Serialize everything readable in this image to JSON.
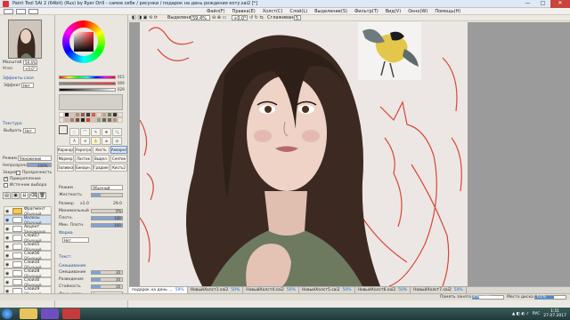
{
  "window": {
    "title": "Paint Tool SAI 2 (64bit) (Rus) by Ryer Drill - самое себе / рисунки / подарок на день рождения коту.sai2 [*]",
    "minimize": "—",
    "maximize": "□",
    "close": "✕"
  },
  "menu": [
    "Файл(F)",
    "Правка(E)",
    "Холст(C)",
    "Слой(L)",
    "Выделение(S)",
    "Фильтр(T)",
    "Вид(V)",
    "Окно(W)",
    "Помощь(H)"
  ],
  "toolbar": {
    "selection_label": "Выделение",
    "zoom_value": "59.4%",
    "rotation_value": "+0.0°",
    "smoothing_label": "Сглаживание",
    "smoothing_value": "5"
  },
  "navigator": {
    "zoom_label": "Масштаб",
    "zoom_value": "59.4%",
    "angle_label": "Угол",
    "angle_value": "+0.0°"
  },
  "layer_props": {
    "effects_label": "Эффекты слоя",
    "effect_label": "Эффект",
    "effect_value": "Нет",
    "texture_label": "Текстура",
    "texture_select_label": "Выбрать",
    "texture_value": "Нет",
    "mode_label": "Режим",
    "mode_value": "Умножение",
    "opacity_label": "Непрозрачность",
    "opacity_value": "100%",
    "clip_label": "Закреп.",
    "clip_label2": "Прозрачность",
    "clip_group_label": "Прикрепление",
    "selection_source_label": "Источник выбора"
  },
  "layers": [
    {
      "name": "Фрагмент",
      "mode": "Обычный",
      "pct": "100%",
      "selected": false,
      "folder": true
    },
    {
      "name": "Волосы",
      "mode": "Обычный",
      "pct": "100%",
      "selected": true,
      "folder": false
    },
    {
      "name": "Акцент",
      "mode": "Умножение",
      "pct": "100%",
      "selected": false,
      "folder": false
    },
    {
      "name": "Слой57",
      "mode": "Обычный",
      "pct": "100%",
      "selected": false,
      "folder": false
    },
    {
      "name": "Слой55",
      "mode": "Обычный",
      "pct": "100%",
      "selected": false,
      "folder": false
    },
    {
      "name": "Слой56",
      "mode": "Обычный",
      "pct": "100%",
      "selected": false,
      "folder": false
    },
    {
      "name": "Слой34",
      "mode": "Обычный",
      "pct": "100%",
      "selected": false,
      "folder": false
    },
    {
      "name": "Слой28",
      "mode": "Обычный",
      "pct": "100%",
      "selected": false,
      "folder": false
    },
    {
      "name": "Слой30",
      "mode": "Обычный",
      "pct": "100%",
      "selected": false,
      "folder": false
    },
    {
      "name": "Слой29",
      "mode": "Обычный",
      "pct": "100%",
      "selected": false,
      "folder": false
    }
  ],
  "color": {
    "h_value": "015",
    "s_value": "009",
    "v_value": "029",
    "swatches": [
      "#ffffff",
      "#000000",
      "#d9c3b5",
      "#b98e7c",
      "#8b5e4e",
      "#4e3428",
      "#d85c53",
      "#f2d3c9",
      "#c7a193",
      "#6e7a5b",
      "#3a3026",
      "#e8e0d6",
      "#f0dccf",
      "#d2b3a2",
      "#a77f6b",
      "#754f3f",
      "#332219",
      "#c24a3f",
      "#e3beaf",
      "#95a07f",
      "#5f6b4a",
      "#806656",
      "#b58f7f",
      "#efe5db"
    ]
  },
  "tools": {
    "row1": [
      "⬚",
      "⌒",
      "✎",
      "⬡",
      "✥",
      "🔍",
      "⟲",
      "✋",
      "⬛"
    ],
    "row2": [
      "A",
      "◐",
      "⌘",
      "⬭",
      "⊕",
      "▧",
      "⟐",
      "⇱",
      "⬜"
    ]
  },
  "brushes": [
    "Карандаш",
    "Аэрограф",
    "Кисть",
    "Акварель",
    "Маркер",
    "Ластик",
    "Выдел.",
    "Снятие",
    "Заливка",
    "Бинарн.",
    "Градиент",
    "Кисть2"
  ],
  "brush_settings": {
    "mode_label": "Режим",
    "mode_value": "Обычный",
    "hardness_label": "Жесткость",
    "size_label": "Размер",
    "size_mult": "x1.0",
    "size_value": "29.0",
    "min_size_label": "Минимальный",
    "min_size_value": "0%",
    "density_label": "Плотн.",
    "density_value": "100",
    "max_density_label": "Мин. Плотн.",
    "max_density_value": "100",
    "shape_label": "Форма",
    "shape_value": "Нет",
    "texture_label": "Текст.",
    "blend_label": "Смешивание",
    "blend_value": "30",
    "dilution_label": "Разведение",
    "dilution_value": "30",
    "persistence_label": "Стойкость",
    "persistence_value": "30",
    "keep_opacity_label": "Двух. разм.",
    "keep_opacity_value": "Фикс.пигмент"
  },
  "canvas_tabs": [
    {
      "name": "подарок на день ...",
      "pct": "59%",
      "active": true
    },
    {
      "name": "НовыйХолст1.sai2",
      "pct": "50%",
      "active": false
    },
    {
      "name": "НовыйХолст4.sai2",
      "pct": "50%",
      "active": false
    },
    {
      "name": "НовыйХолст5.sai2",
      "pct": "50%",
      "active": false
    },
    {
      "name": "НовыйХолст6.sai2",
      "pct": "50%",
      "active": false
    },
    {
      "name": "НовыйХолст7.sai2",
      "pct": "50%",
      "active": false
    }
  ],
  "status": {
    "memory_label": "Память занято",
    "memory_value": "8%(21%)",
    "memory_fill": 0.21,
    "disk_label": "Место диска",
    "disk_value": "61%",
    "disk_fill": 0.61
  },
  "taskbar": {
    "lang": "РУС",
    "time": "1:51",
    "date": "27.07.2017"
  }
}
